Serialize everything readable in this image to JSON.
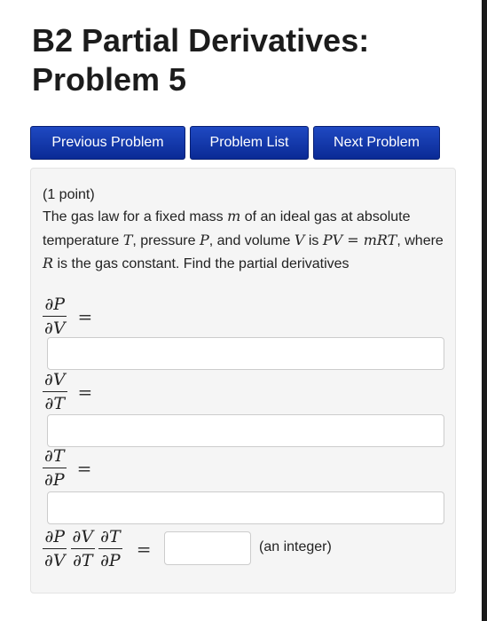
{
  "title": "B2 Partial Derivatives: Problem 5",
  "nav": {
    "previous": "Previous Problem",
    "list": "Problem List",
    "next": "Next Problem"
  },
  "problem": {
    "points": "(1 point)",
    "statement": {
      "t1": "The gas law for a fixed mass ",
      "m": "m",
      "t2": " of an ideal gas at absolute temperature ",
      "T": "T",
      "t3": ", pressure ",
      "P": "P",
      "t4": ", and volume ",
      "V": "V",
      "t5": " is ",
      "law": "PV = mRT",
      "t6": ", where ",
      "R": "R",
      "t7": " is the gas constant. Find the partial derivatives"
    },
    "derivatives": [
      {
        "num": "∂P",
        "den": "∂V",
        "eq": "=",
        "value": ""
      },
      {
        "num": "∂V",
        "den": "∂T",
        "eq": "=",
        "value": ""
      },
      {
        "num": "∂T",
        "den": "∂P",
        "eq": "=",
        "value": ""
      }
    ],
    "product": {
      "terms": [
        {
          "num": "∂P",
          "den": "∂V"
        },
        {
          "num": "∂V",
          "den": "∂T"
        },
        {
          "num": "∂T",
          "den": "∂P"
        }
      ],
      "eq": "=",
      "value": "",
      "hint": "(an integer)"
    }
  }
}
